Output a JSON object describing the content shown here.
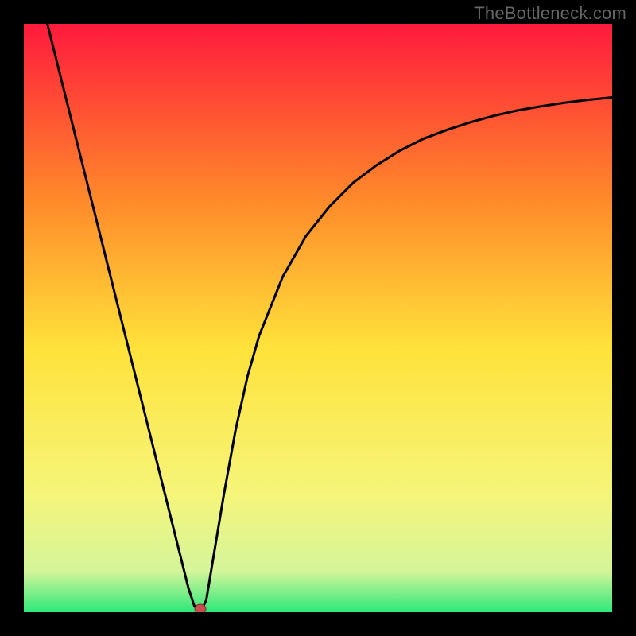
{
  "watermark": "TheBottleneck.com",
  "chart_data": {
    "type": "line",
    "title": "",
    "xlabel": "",
    "ylabel": "",
    "xlim": [
      0,
      100
    ],
    "ylim": [
      0,
      100
    ],
    "x": [
      4,
      6,
      8,
      10,
      12,
      14,
      16,
      18,
      20,
      22,
      24,
      26,
      27,
      28,
      29,
      30,
      31,
      32,
      34,
      36,
      38,
      40,
      44,
      48,
      52,
      56,
      60,
      64,
      68,
      72,
      76,
      80,
      84,
      88,
      92,
      96,
      100
    ],
    "values": [
      100,
      92,
      84,
      76,
      68,
      60,
      52,
      44,
      36,
      28,
      20,
      12,
      8,
      4,
      1,
      0,
      2,
      8,
      20,
      31,
      40,
      47,
      57,
      64,
      69,
      73,
      76,
      78.5,
      80.5,
      82,
      83.3,
      84.4,
      85.3,
      86,
      86.6,
      87.1,
      87.5
    ],
    "marker": {
      "x": 30,
      "y": 0
    },
    "gradient_colors": {
      "top": "#ff1a3d",
      "mid_high": "#ff8a2a",
      "mid": "#ffe23a",
      "mid_low": "#f5f57a",
      "low": "#d5f59a",
      "bottom": "#2ee87a"
    }
  }
}
